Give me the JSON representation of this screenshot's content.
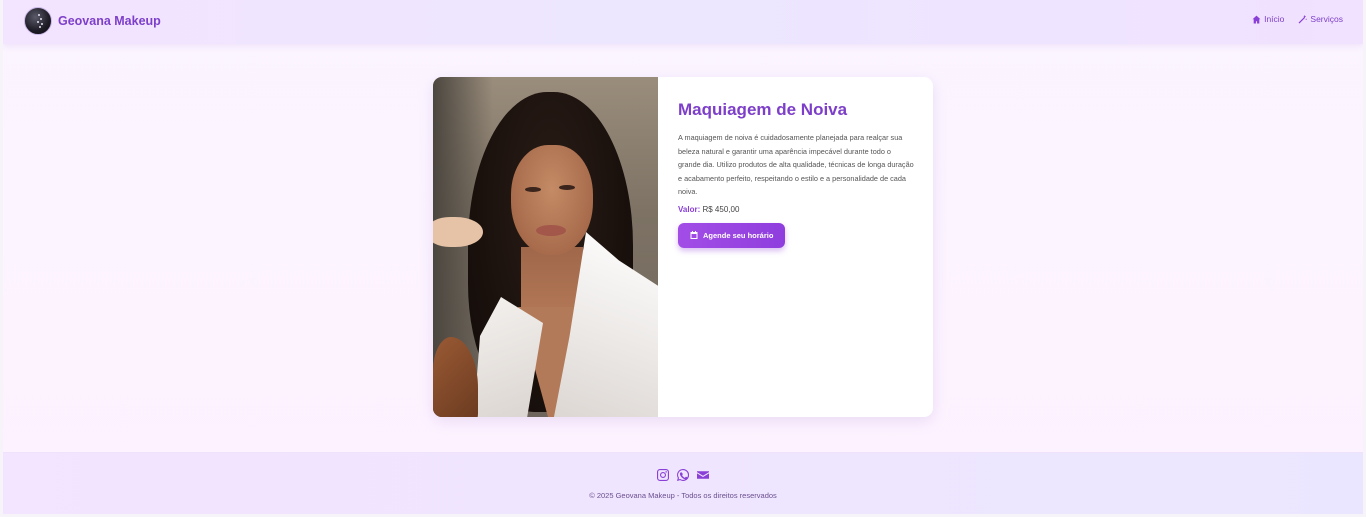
{
  "header": {
    "brand_name": "Geovana Makeup",
    "nav": [
      {
        "label": "Início",
        "icon": "home-icon"
      },
      {
        "label": "Serviços",
        "icon": "magic-wand-icon"
      }
    ]
  },
  "service": {
    "title": "Maquiagem de Noiva",
    "description": "A maquiagem de noiva é cuidadosamente planejada para realçar sua beleza natural e garantir uma aparência impecável durante todo o grande dia. Utilizo produtos de alta qualidade, técnicas de longa duração e acabamento perfeito, respeitando o estilo e a personalidade de cada noiva.",
    "price_label": "Valor:",
    "price_value": "R$ 450,00",
    "cta_label": "Agende seu horário",
    "cta_icon": "calendar-icon",
    "image": "bride-portrait"
  },
  "footer": {
    "socials": [
      "instagram-icon",
      "whatsapp-icon",
      "envelope-icon"
    ],
    "copyright": "© 2025 Geovana Makeup - Todos os direitos reservados"
  },
  "colors": {
    "accent": "#7d3fc9",
    "button": "#9b47e3",
    "header_bg": "#f0e4ff",
    "page_bg": "#fcf3ff"
  }
}
